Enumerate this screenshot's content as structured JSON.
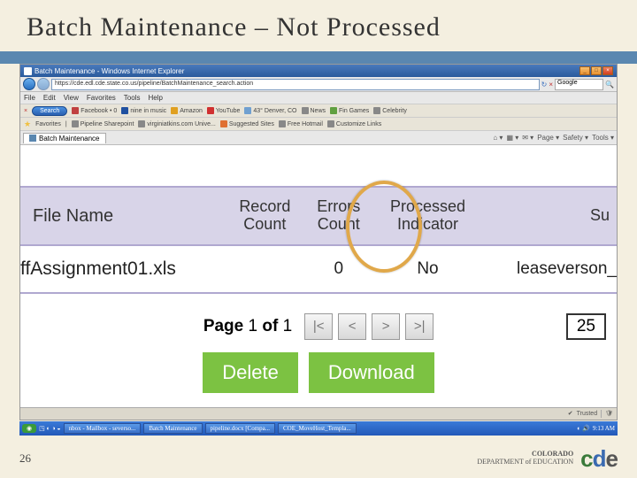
{
  "slide": {
    "title": "Batch Maintenance – Not Processed",
    "page_number": "26"
  },
  "window": {
    "title": "Batch Maintenance - Windows Internet Explorer",
    "url": "https://cde.edl.cde.state.co.us/pipeline/BatchMaintenance_search.action",
    "search_engine": "Google"
  },
  "menus": [
    "File",
    "Edit",
    "View",
    "Favorites",
    "Tools",
    "Help"
  ],
  "link_row": {
    "search_label": "Search",
    "items": [
      "Facebook",
      "nine in music",
      "Amazon",
      "YouTube",
      "43° Denver, CO",
      "News",
      "Fin Games",
      "Celebrity"
    ]
  },
  "fav_row": {
    "label": "Favorites",
    "items": [
      "Pipeline Sharepoint",
      "virginiatkins.com Unive...",
      "Suggested Sites",
      "Free Hotmail",
      "Customize Links"
    ]
  },
  "tab": {
    "label": "Batch Maintenance"
  },
  "tab_tools": [
    "Home",
    "Page",
    "Safety",
    "Tools"
  ],
  "table": {
    "headers": {
      "file_name": "File Name",
      "record_count": "Record\nCount",
      "errors_count": "Errors\nCount",
      "processed_indicator": "Processed\nIndicator",
      "submitter": "Su"
    },
    "row": {
      "file_name": "ffAssignment01.xls",
      "record_count": "",
      "errors_count": "0",
      "processed_indicator": "No",
      "submitter": "leaseverson_"
    }
  },
  "pager": {
    "label_page": "Page",
    "current": "1",
    "of": "of",
    "total": "1",
    "first": "|<",
    "prev": "<",
    "next": ">",
    "last": ">|",
    "page_size": "25"
  },
  "actions": {
    "delete": "Delete",
    "download": "Download"
  },
  "status": {
    "zone": "Trusted"
  },
  "taskbar": {
    "items": [
      "nbox - Mailbox - severso...",
      "Batch Maintenance",
      "pipeline.docx [Compa...",
      "COE_MoveHost_Templa..."
    ],
    "time": "9:13 AM"
  },
  "brand": {
    "line1": "COLORADO",
    "line2": "DEPARTMENT of EDUCATION"
  }
}
